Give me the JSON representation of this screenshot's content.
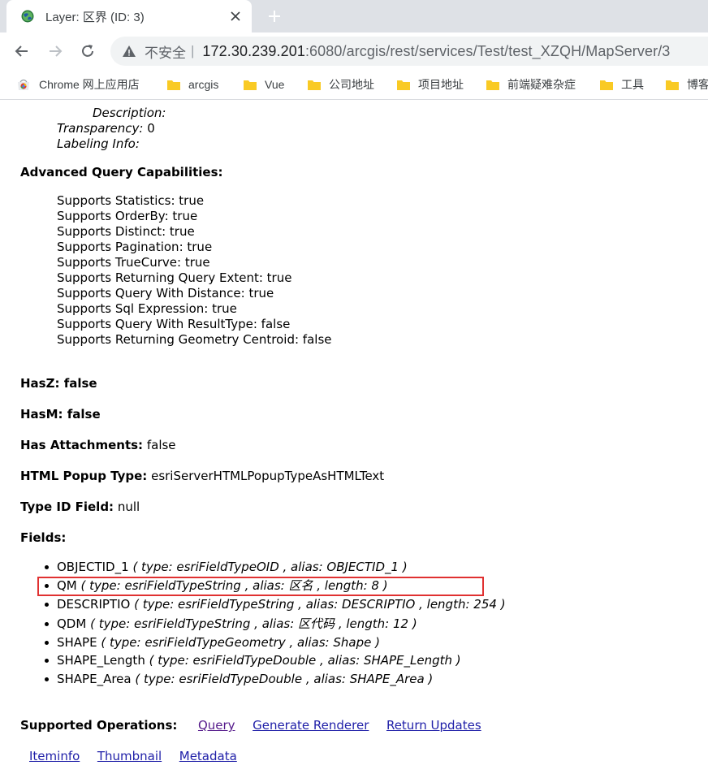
{
  "browser": {
    "tab_title": "Layer: 区界 (ID: 3)",
    "url_insecure_label": "不安全",
    "url_separator": "|",
    "url_host": "172.30.239.201",
    "url_rest": ":6080/arcgis/rest/services/Test/test_XZQH/MapServer/3",
    "bookmarks": [
      "Chrome 网上应用店",
      "arcgis",
      "Vue",
      "公司地址",
      "项目地址",
      "前端疑难杂症",
      "工具",
      "博客"
    ]
  },
  "page": {
    "desc_label": "Description:",
    "transparency_label": "Transparency:",
    "transparency_value": "0",
    "labeling_label": "Labeling Info:",
    "aqc_title": "Advanced Query Capabilities:",
    "aqc": [
      "Supports Statistics: true",
      "Supports OrderBy: true",
      "Supports Distinct: true",
      "Supports Pagination: true",
      "Supports TrueCurve: true",
      "Supports Returning Query Extent: true",
      "Supports Query With Distance: true",
      "Supports Sql Expression: true",
      "Supports Query With ResultType: false",
      "Supports Returning Geometry Centroid: false"
    ],
    "hasz": "HasZ: false",
    "hasm": "HasM: false",
    "has_attachments_label": "Has Attachments:",
    "has_attachments_value": "false",
    "html_popup_label": "HTML Popup Type:",
    "html_popup_value": "esriServerHTMLPopupTypeAsHTMLText",
    "type_id_label": "Type ID Field:",
    "type_id_value": "null",
    "fields_title": "Fields:",
    "fields": [
      {
        "name": "OBJECTID_1",
        "detail": "( type: esriFieldTypeOID , alias: OBJECTID_1 )"
      },
      {
        "name": "QM",
        "detail": "( type: esriFieldTypeString , alias: 区名 , length: 8 )"
      },
      {
        "name": "DESCRIPTIO",
        "detail": "( type: esriFieldTypeString , alias: DESCRIPTIO , length: 254 )"
      },
      {
        "name": "QDM",
        "detail": "( type: esriFieldTypeString , alias: 区代码 , length: 12 )"
      },
      {
        "name": "SHAPE",
        "detail": "( type: esriFieldTypeGeometry , alias: Shape )"
      },
      {
        "name": "SHAPE_Length",
        "detail": "( type: esriFieldTypeDouble , alias: SHAPE_Length )"
      },
      {
        "name": "SHAPE_Area",
        "detail": "( type: esriFieldTypeDouble , alias: SHAPE_Area )"
      }
    ],
    "supported_ops_label": "Supported Operations:",
    "ops": [
      "Query",
      "Generate Renderer",
      "Return Updates"
    ],
    "links": [
      "Iteminfo",
      "Thumbnail",
      "Metadata"
    ]
  },
  "colors": {
    "link": "#1f1fa8",
    "visited_link": "#551a8b",
    "highlight_box": "#e03131"
  }
}
